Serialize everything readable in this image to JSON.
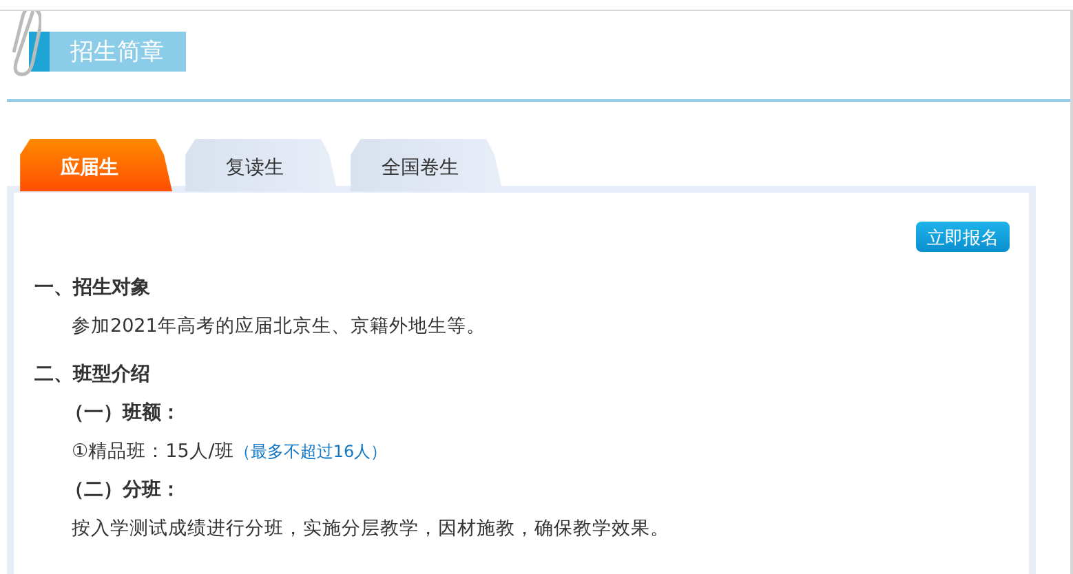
{
  "title": "招生简章",
  "tabs": [
    {
      "label": "应届生",
      "selected": true
    },
    {
      "label": "复读生",
      "selected": false
    },
    {
      "label": "全国卷生",
      "selected": false
    }
  ],
  "signup_button": "立即报名",
  "sections": [
    {
      "heading": "一、招生对象",
      "items": [
        {
          "kind": "paragraph",
          "text": "参加2021年高考的应届北京生、京籍外地生等。"
        }
      ]
    },
    {
      "heading": "二、班型介绍",
      "items": [
        {
          "kind": "subheading",
          "text": "（一）班额："
        },
        {
          "kind": "quota",
          "text": "①精品班：15人/班",
          "note": "（最多不超过16人）"
        },
        {
          "kind": "subheading",
          "text": "（二）分班："
        },
        {
          "kind": "paragraph",
          "text": "按入学测试成绩进行分班，实施分层教学，因材施教，确保教学效果。"
        }
      ]
    }
  ]
}
